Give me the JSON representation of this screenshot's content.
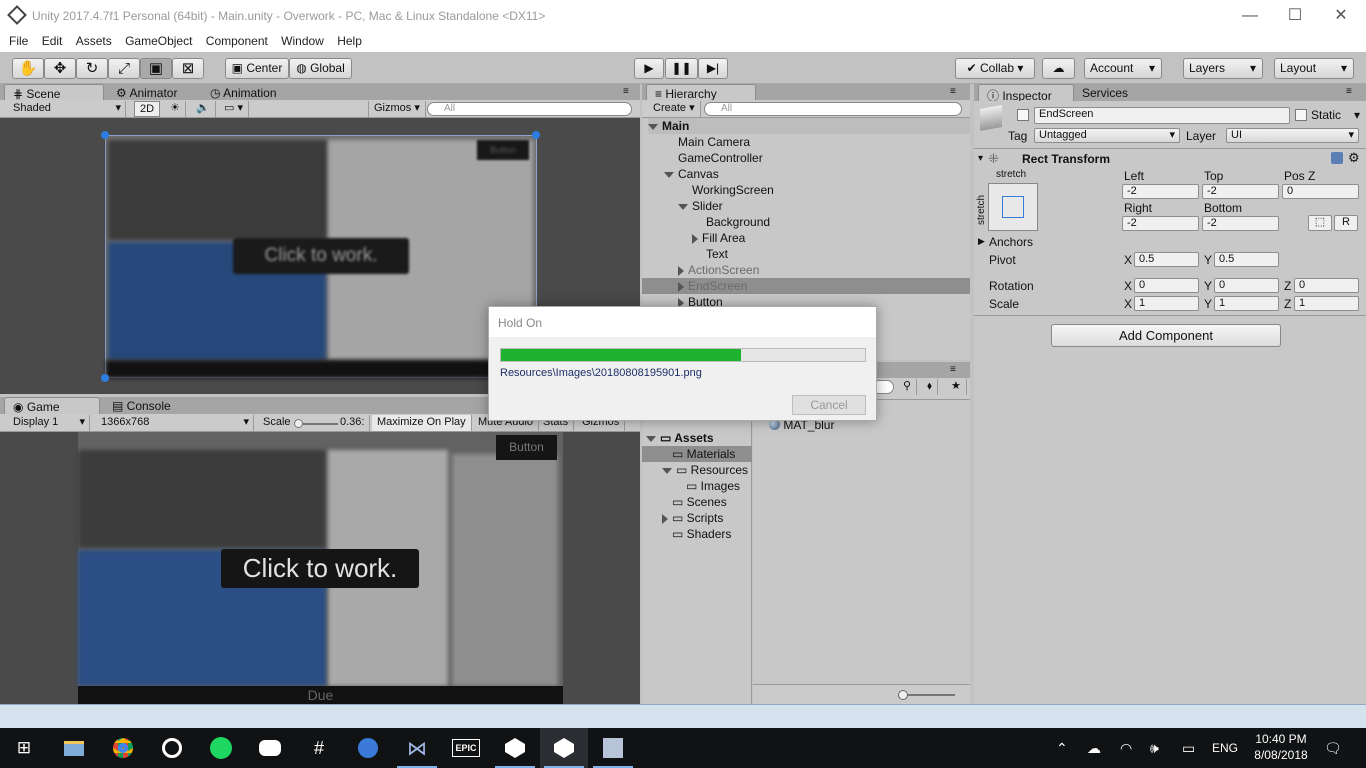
{
  "window": {
    "title": "Unity 2017.4.7f1 Personal (64bit) - Main.unity - Overwork - PC, Mac & Linux Standalone <DX11>",
    "minimize": "—",
    "maximize": "☐",
    "close": "✕"
  },
  "menu": [
    "File",
    "Edit",
    "Assets",
    "GameObject",
    "Component",
    "Window",
    "Help"
  ],
  "toolbar": {
    "pivot": "Center",
    "space": "Global",
    "collab": "Collab ▾",
    "account": "Account",
    "layers": "Layers",
    "layout": "Layout"
  },
  "scene": {
    "tabs": [
      "Scene",
      "Animator",
      "Animation"
    ],
    "shading": "Shaded",
    "mode2d": "2D",
    "gizmos": "Gizmos",
    "search_placeholder": "All",
    "overlay_text": "Click to work.",
    "button_text": "Button",
    "footer_text": "Due"
  },
  "game": {
    "tabs": [
      "Game",
      "Console"
    ],
    "display": "Display 1",
    "resolution": "1366x768",
    "scale_label": "Scale",
    "scale_value": "0.36:",
    "maximize": "Maximize On Play",
    "mute": "Mute Audio",
    "stats": "Stats",
    "gizmos": "Gizmos",
    "overlay_text": "Click to work.",
    "button_text": "Button",
    "footer_text": "Due"
  },
  "hierarchy": {
    "tab": "Hierarchy",
    "create": "Create ▾",
    "search_placeholder": "All",
    "scene_name": "Main",
    "items": [
      {
        "label": "Main Camera",
        "depth": 1,
        "arrow": ""
      },
      {
        "label": "GameController",
        "depth": 1,
        "arrow": ""
      },
      {
        "label": "Canvas",
        "depth": 1,
        "arrow": "down"
      },
      {
        "label": "WorkingScreen",
        "depth": 2,
        "arrow": ""
      },
      {
        "label": "Slider",
        "depth": 2,
        "arrow": "down"
      },
      {
        "label": "Background",
        "depth": 3,
        "arrow": ""
      },
      {
        "label": "Fill Area",
        "depth": 3,
        "arrow": "right"
      },
      {
        "label": "Text",
        "depth": 3,
        "arrow": ""
      },
      {
        "label": "ActionScreen",
        "depth": 2,
        "arrow": "right",
        "inactive": true
      },
      {
        "label": "EndScreen",
        "depth": 2,
        "arrow": "right",
        "inactive": true,
        "selected": true
      },
      {
        "label": "Button",
        "depth": 2,
        "arrow": "right"
      }
    ]
  },
  "project": {
    "root": "Assets",
    "folders": [
      {
        "label": "Materials",
        "depth": 1,
        "selected": true
      },
      {
        "label": "Resources",
        "depth": 1,
        "arrow": "down"
      },
      {
        "label": "Images",
        "depth": 2
      },
      {
        "label": "Scenes",
        "depth": 1
      },
      {
        "label": "Scripts",
        "depth": 1,
        "arrow": "right"
      },
      {
        "label": "Shaders",
        "depth": 1
      }
    ],
    "asset": "MAT_blur"
  },
  "inspector": {
    "tabs": [
      "Inspector",
      "Services"
    ],
    "object_name": "EndScreen",
    "static_label": "Static",
    "tag_label": "Tag",
    "tag_value": "Untagged",
    "layer_label": "Layer",
    "layer_value": "UI",
    "component": "Rect Transform",
    "anchor_h": "stretch",
    "anchor_v": "stretch",
    "left_label": "Left",
    "left": "-2",
    "top_label": "Top",
    "top": "-2",
    "posz_label": "Pos Z",
    "posz": "0",
    "right_label": "Right",
    "right": "-2",
    "bottom_label": "Bottom",
    "bottom": "-2",
    "anchors_label": "Anchors",
    "pivot_label": "Pivot",
    "pivot_x": "0.5",
    "pivot_y": "0.5",
    "rotation_label": "Rotation",
    "rot_x": "0",
    "rot_y": "0",
    "rot_z": "0",
    "scale_label": "Scale",
    "scale_x": "1",
    "scale_y": "1",
    "scale_z": "1",
    "x": "X",
    "y": "Y",
    "z": "Z",
    "r_button": "R",
    "add_component": "Add Component"
  },
  "dialog": {
    "title": "Hold On",
    "progress_fraction": 0.66,
    "path": "Resources\\Images\\20180808195901.png",
    "cancel": "Cancel",
    "progress_color": "#1fb22f"
  },
  "taskbar": {
    "apps": [
      "windows-icon",
      "explorer-icon",
      "chrome-icon",
      "groove-icon",
      "spotify-icon",
      "discord-icon",
      "slack-icon",
      "maps-icon",
      "visualstudio-icon",
      "epic-icon",
      "unity-icon",
      "unity-icon",
      "blender-icon"
    ],
    "epic_label": "EPIC",
    "lang": "ENG",
    "time": "10:40 PM",
    "date": "8/08/2018"
  }
}
